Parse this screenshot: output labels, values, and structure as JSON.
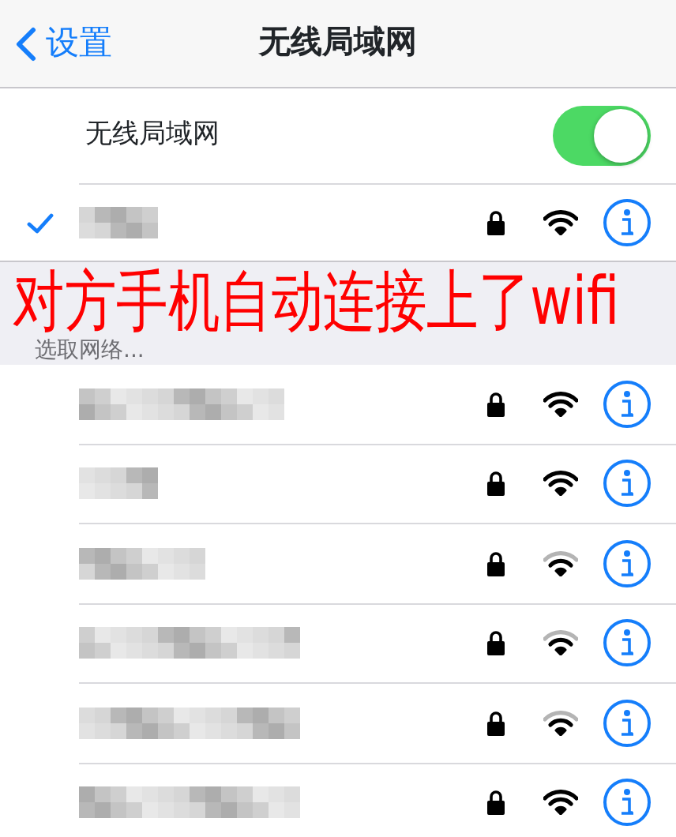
{
  "nav": {
    "back_label": "设置",
    "title": "无线局域网"
  },
  "wifi_toggle": {
    "label": "无线局域网",
    "on": true
  },
  "connected_network": {
    "connected": true,
    "locked": true,
    "strong_signal": true
  },
  "section_header": "选取网络...",
  "overlay_caption": "对方手机自动连接上了wifi",
  "networks": [
    {
      "locked": true,
      "strong_signal": true
    },
    {
      "locked": true,
      "strong_signal": true
    },
    {
      "locked": true,
      "strong_signal": false
    },
    {
      "locked": true,
      "strong_signal": false
    },
    {
      "locked": true,
      "strong_signal": false
    },
    {
      "locked": true,
      "strong_signal": true
    }
  ]
}
